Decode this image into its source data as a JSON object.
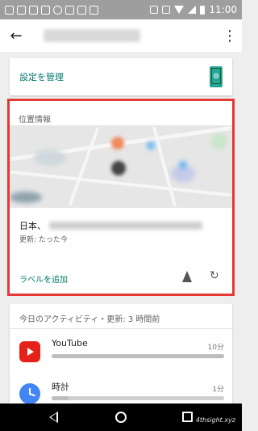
{
  "status_bar": {
    "time": "11:00"
  },
  "app_bar": {
    "back_icon": "arrow-left-icon",
    "more_icon": "more-vert-icon"
  },
  "settings_card": {
    "label": "設定を管理",
    "icon": "phone-settings-icon",
    "accent": "#26a69a"
  },
  "location_card": {
    "title": "位置情報",
    "address_prefix": "日本、",
    "updated": "更新: たった今",
    "add_label": "ラベルを追加",
    "highlight_color": "#e53935"
  },
  "activity": {
    "header": "今日のアクティビティ・更新: 3 時間前",
    "apps": [
      {
        "name": "YouTube",
        "time": "10分",
        "usage": 1.0
      },
      {
        "name": "時計",
        "time": "1分",
        "usage": 0.1
      }
    ]
  },
  "watermark": "4thsight.xyz"
}
